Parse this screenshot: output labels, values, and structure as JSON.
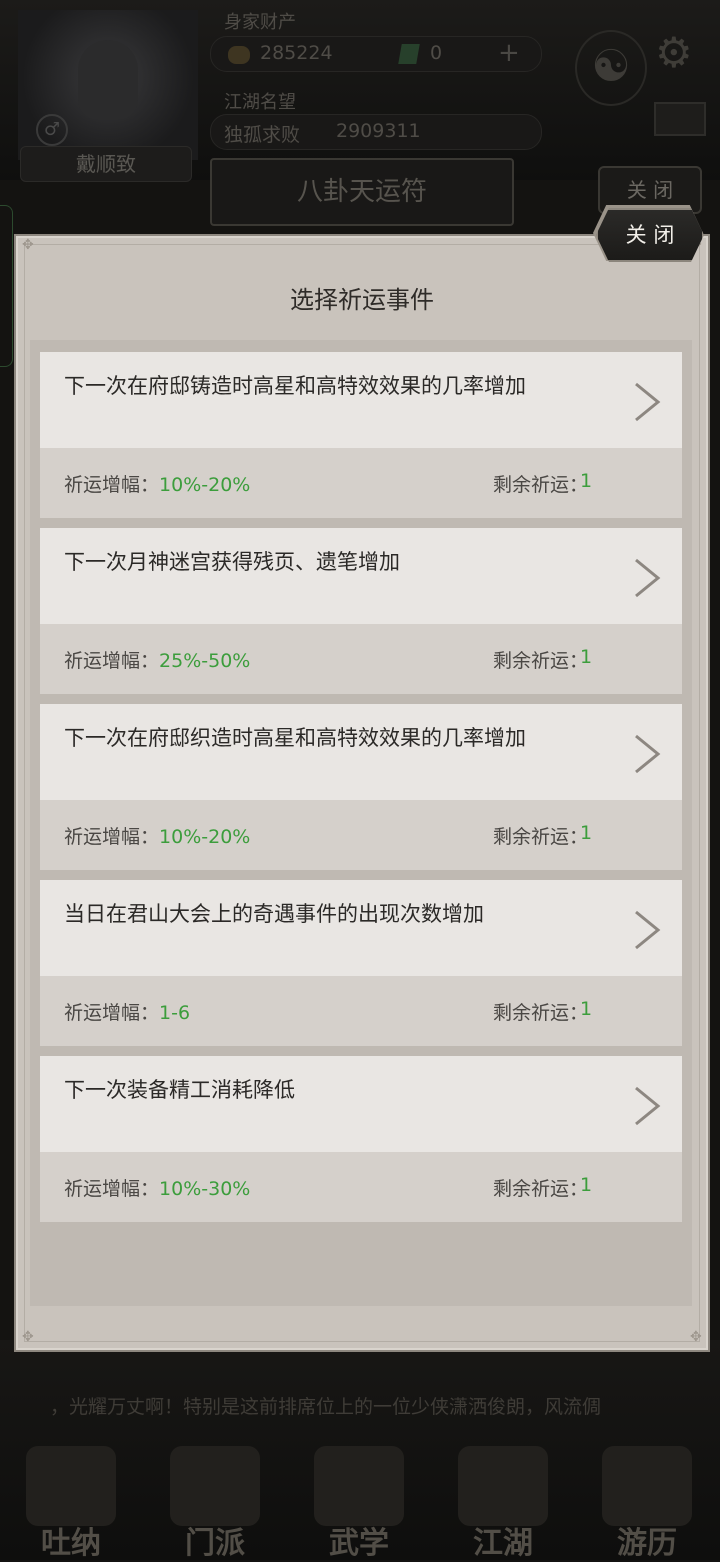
{
  "background": {
    "player_name": "戴顺致",
    "wealth_label": "身家财产",
    "coins": "285224",
    "jade": "0",
    "reputation_label": "江湖名望",
    "title": "独孤求败",
    "reputation": "2909311",
    "panel_title": "八卦天运符",
    "close_label": "关 闭",
    "marquee": "，光耀万丈啊！特别是这前排席位上的一位少侠潇洒俊朗，风流倜",
    "nav": [
      "吐纳",
      "门派",
      "武学",
      "江湖",
      "游历"
    ]
  },
  "dialog": {
    "title": "选择祈运事件",
    "close_label": "关 闭",
    "gain_prefix": "祈运增幅：",
    "remain_prefix": "剩余祈运：",
    "events": [
      {
        "desc": "下一次在府邸铸造时高星和高特效效果的几率增加",
        "gain": "10%-20%",
        "remain": "1"
      },
      {
        "desc": "下一次月神迷宫获得残页、遗笔增加",
        "gain": "25%-50%",
        "remain": "1"
      },
      {
        "desc": "下一次在府邸织造时高星和高特效效果的几率增加",
        "gain": "10%-20%",
        "remain": "1"
      },
      {
        "desc": "当日在君山大会上的奇遇事件的出现次数增加",
        "gain": "1-6",
        "remain": "1"
      },
      {
        "desc": "下一次装备精工消耗降低",
        "gain": "10%-30%",
        "remain": "1"
      }
    ]
  },
  "colors": {
    "accent_green": "#3c9d3c",
    "dialog_bg": "#c9c3bc"
  }
}
